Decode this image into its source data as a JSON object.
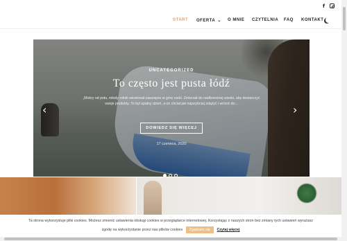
{
  "social": {
    "facebook_icon": "f",
    "instagram_icon": "instagram-icon"
  },
  "nav": {
    "items": [
      {
        "label": "START",
        "active": true
      },
      {
        "label": "OFERTA",
        "has_dropdown": true
      },
      {
        "label": "O MNIE"
      },
      {
        "label": "CZYTELNIA"
      },
      {
        "label": "FAQ"
      },
      {
        "label": "KONTAKT"
      }
    ],
    "dropdown_glyph": "⌄",
    "theme_icon": "moon-icon"
  },
  "slider": {
    "category": "UNCATEGORIZED",
    "title": "To często jest pusta łódź",
    "excerpt": "„Mokry od potu, młody rolnik wiosłował zawzięcie w górę rzeki. Zmierzał do nadbrzeżnej wioski, aby dostarczyć swoje produkty. To był upalny dzień, a on chciał jak najszybciej zdążyć i wrócić do...",
    "read_more": "DOWIEDZ SIĘ WIĘCEJ",
    "date": "17 czerwca, 2020",
    "prev_glyph": "‹",
    "next_glyph": "›",
    "slide_count": 3,
    "active_slide": 1
  },
  "cookie": {
    "text": "Ta strona wykorzystuje pliki cookies. Możesz zmienić ustawienia obsługi cookies w przeglądarce internetowej. Korzystając z naszych stron bez zmiany tych ustawień wyrażasz",
    "text2": "zgodę na wykorzystanie przez nas plików cookies",
    "accept": "Zgadzam się",
    "more": "Czytaj więcej",
    "accent_color": "#efbe86"
  },
  "colors": {
    "active_nav": "#e8a26a"
  }
}
